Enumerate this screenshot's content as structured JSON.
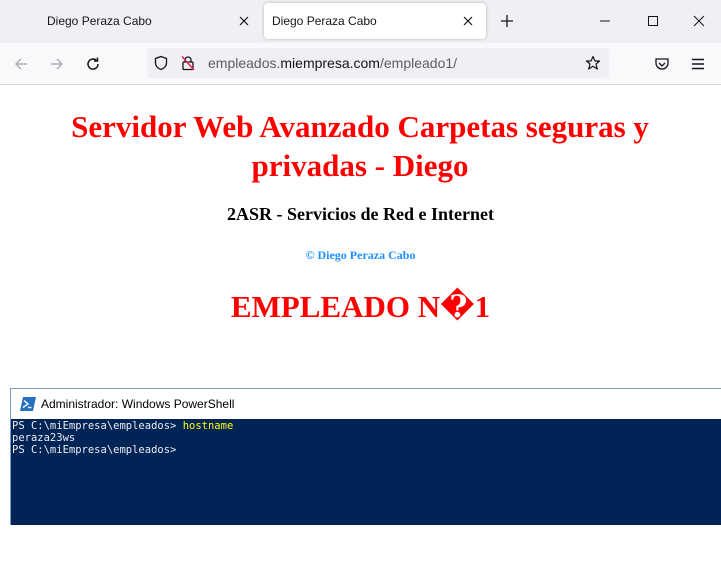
{
  "browser": {
    "tabs": [
      {
        "label": "Diego Peraza Cabo",
        "active": false
      },
      {
        "label": "Diego Peraza Cabo",
        "active": true
      }
    ],
    "url": {
      "prefix": "empleados.",
      "host": "miempresa.com",
      "path": "/empleado1/"
    }
  },
  "page": {
    "title": "Servidor Web Avanzado Carpetas seguras y privadas - Diego",
    "subtitle": "2ASR - Servicios de Red e Internet",
    "copyright": "© Diego Peraza Cabo",
    "heading": "EMPLEADO N�1",
    "colors": {
      "title": "#ff0000",
      "copyright": "#1e90ff"
    }
  },
  "powershell": {
    "window_title": "Administrador: Windows PowerShell",
    "lines": [
      {
        "prompt": "PS C:\\miEmpresa\\empleados> ",
        "command": "hostname"
      },
      {
        "prompt": "peraza23ws",
        "command": ""
      },
      {
        "prompt": "PS C:\\miEmpresa\\empleados>",
        "command": ""
      }
    ],
    "colors": {
      "background": "#012456",
      "command": "#ffff00"
    }
  }
}
